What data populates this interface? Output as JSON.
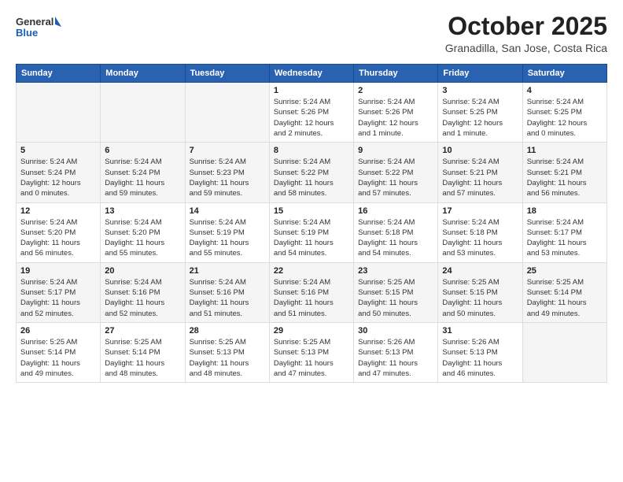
{
  "header": {
    "logo_general": "General",
    "logo_blue": "Blue",
    "month_title": "October 2025",
    "subtitle": "Granadilla, San Jose, Costa Rica"
  },
  "weekdays": [
    "Sunday",
    "Monday",
    "Tuesday",
    "Wednesday",
    "Thursday",
    "Friday",
    "Saturday"
  ],
  "weeks": [
    [
      {
        "day": "",
        "info": ""
      },
      {
        "day": "",
        "info": ""
      },
      {
        "day": "",
        "info": ""
      },
      {
        "day": "1",
        "info": "Sunrise: 5:24 AM\nSunset: 5:26 PM\nDaylight: 12 hours\nand 2 minutes."
      },
      {
        "day": "2",
        "info": "Sunrise: 5:24 AM\nSunset: 5:26 PM\nDaylight: 12 hours\nand 1 minute."
      },
      {
        "day": "3",
        "info": "Sunrise: 5:24 AM\nSunset: 5:25 PM\nDaylight: 12 hours\nand 1 minute."
      },
      {
        "day": "4",
        "info": "Sunrise: 5:24 AM\nSunset: 5:25 PM\nDaylight: 12 hours\nand 0 minutes."
      }
    ],
    [
      {
        "day": "5",
        "info": "Sunrise: 5:24 AM\nSunset: 5:24 PM\nDaylight: 12 hours\nand 0 minutes."
      },
      {
        "day": "6",
        "info": "Sunrise: 5:24 AM\nSunset: 5:24 PM\nDaylight: 11 hours\nand 59 minutes."
      },
      {
        "day": "7",
        "info": "Sunrise: 5:24 AM\nSunset: 5:23 PM\nDaylight: 11 hours\nand 59 minutes."
      },
      {
        "day": "8",
        "info": "Sunrise: 5:24 AM\nSunset: 5:22 PM\nDaylight: 11 hours\nand 58 minutes."
      },
      {
        "day": "9",
        "info": "Sunrise: 5:24 AM\nSunset: 5:22 PM\nDaylight: 11 hours\nand 57 minutes."
      },
      {
        "day": "10",
        "info": "Sunrise: 5:24 AM\nSunset: 5:21 PM\nDaylight: 11 hours\nand 57 minutes."
      },
      {
        "day": "11",
        "info": "Sunrise: 5:24 AM\nSunset: 5:21 PM\nDaylight: 11 hours\nand 56 minutes."
      }
    ],
    [
      {
        "day": "12",
        "info": "Sunrise: 5:24 AM\nSunset: 5:20 PM\nDaylight: 11 hours\nand 56 minutes."
      },
      {
        "day": "13",
        "info": "Sunrise: 5:24 AM\nSunset: 5:20 PM\nDaylight: 11 hours\nand 55 minutes."
      },
      {
        "day": "14",
        "info": "Sunrise: 5:24 AM\nSunset: 5:19 PM\nDaylight: 11 hours\nand 55 minutes."
      },
      {
        "day": "15",
        "info": "Sunrise: 5:24 AM\nSunset: 5:19 PM\nDaylight: 11 hours\nand 54 minutes."
      },
      {
        "day": "16",
        "info": "Sunrise: 5:24 AM\nSunset: 5:18 PM\nDaylight: 11 hours\nand 54 minutes."
      },
      {
        "day": "17",
        "info": "Sunrise: 5:24 AM\nSunset: 5:18 PM\nDaylight: 11 hours\nand 53 minutes."
      },
      {
        "day": "18",
        "info": "Sunrise: 5:24 AM\nSunset: 5:17 PM\nDaylight: 11 hours\nand 53 minutes."
      }
    ],
    [
      {
        "day": "19",
        "info": "Sunrise: 5:24 AM\nSunset: 5:17 PM\nDaylight: 11 hours\nand 52 minutes."
      },
      {
        "day": "20",
        "info": "Sunrise: 5:24 AM\nSunset: 5:16 PM\nDaylight: 11 hours\nand 52 minutes."
      },
      {
        "day": "21",
        "info": "Sunrise: 5:24 AM\nSunset: 5:16 PM\nDaylight: 11 hours\nand 51 minutes."
      },
      {
        "day": "22",
        "info": "Sunrise: 5:24 AM\nSunset: 5:16 PM\nDaylight: 11 hours\nand 51 minutes."
      },
      {
        "day": "23",
        "info": "Sunrise: 5:25 AM\nSunset: 5:15 PM\nDaylight: 11 hours\nand 50 minutes."
      },
      {
        "day": "24",
        "info": "Sunrise: 5:25 AM\nSunset: 5:15 PM\nDaylight: 11 hours\nand 50 minutes."
      },
      {
        "day": "25",
        "info": "Sunrise: 5:25 AM\nSunset: 5:14 PM\nDaylight: 11 hours\nand 49 minutes."
      }
    ],
    [
      {
        "day": "26",
        "info": "Sunrise: 5:25 AM\nSunset: 5:14 PM\nDaylight: 11 hours\nand 49 minutes."
      },
      {
        "day": "27",
        "info": "Sunrise: 5:25 AM\nSunset: 5:14 PM\nDaylight: 11 hours\nand 48 minutes."
      },
      {
        "day": "28",
        "info": "Sunrise: 5:25 AM\nSunset: 5:13 PM\nDaylight: 11 hours\nand 48 minutes."
      },
      {
        "day": "29",
        "info": "Sunrise: 5:25 AM\nSunset: 5:13 PM\nDaylight: 11 hours\nand 47 minutes."
      },
      {
        "day": "30",
        "info": "Sunrise: 5:26 AM\nSunset: 5:13 PM\nDaylight: 11 hours\nand 47 minutes."
      },
      {
        "day": "31",
        "info": "Sunrise: 5:26 AM\nSunset: 5:13 PM\nDaylight: 11 hours\nand 46 minutes."
      },
      {
        "day": "",
        "info": ""
      }
    ]
  ]
}
